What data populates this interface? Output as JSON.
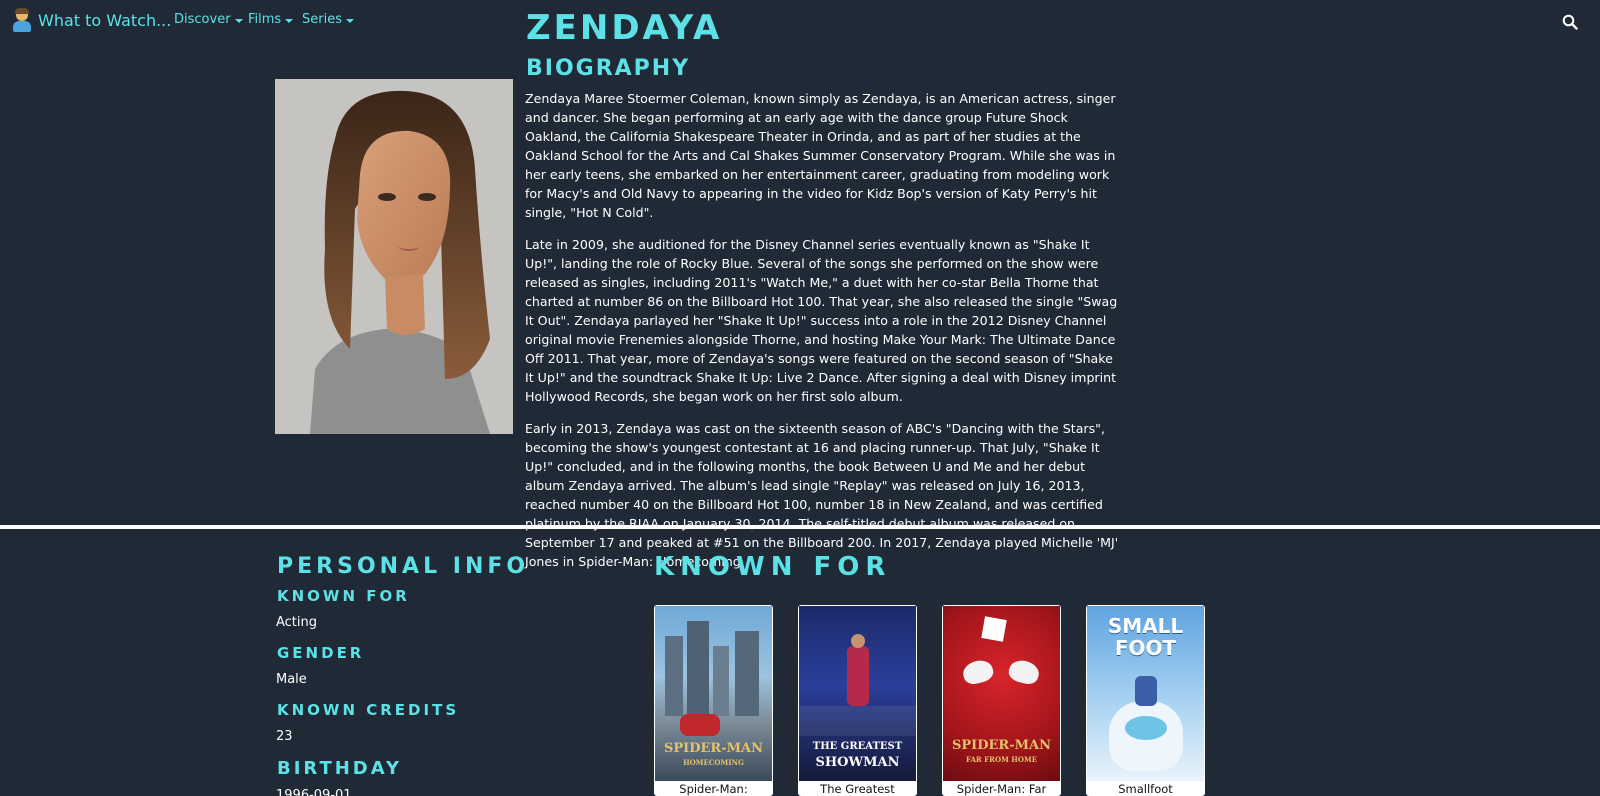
{
  "nav": {
    "brand": "What to Watch...",
    "items": [
      {
        "label": "Discover"
      },
      {
        "label": "Films"
      },
      {
        "label": "Series"
      }
    ]
  },
  "person": {
    "name": "ZENDAYA",
    "biography_heading": "BIOGRAPHY",
    "biography": [
      "Zendaya Maree Stoermer Coleman, known simply as Zendaya, is an American actress, singer and dancer. She began performing at an early age with the dance group Future Shock Oakland, the California Shakespeare Theater in Orinda, and as part of her studies at the Oakland School for the Arts and Cal Shakes Summer Conservatory Program. While she was in her early teens, she embarked on her entertainment career, graduating from modeling work for Macy's and Old Navy to appearing in the video for Kidz Bop's version of Katy Perry's hit single, \"Hot N Cold\".",
      "Late in 2009, she auditioned for the Disney Channel series eventually known as \"Shake It Up!\", landing the role of Rocky Blue. Several of the songs she performed on the show were released as singles, including 2011's \"Watch Me,\" a duet with her co-star Bella Thorne that charted at number 86 on the Billboard Hot 100. That year, she also released the single \"Swag It Out\". Zendaya parlayed her \"Shake It Up!\" success into a role in the 2012 Disney Channel original movie Frenemies alongside Thorne, and hosting Make Your Mark: The Ultimate Dance Off 2011. That year, more of Zendaya's songs were featured on the second season of \"Shake It Up!\" and the soundtrack Shake It Up: Live 2 Dance. After signing a deal with Disney imprint Hollywood Records, she began work on her first solo album.",
      "Early in 2013, Zendaya was cast on the sixteenth season of ABC's \"Dancing with the Stars\", becoming the show's youngest contestant at 16 and placing runner-up. That July, \"Shake It Up!\" concluded, and in the following months, the book Between U and Me and her debut album Zendaya arrived. The album's lead single \"Replay\" was released on July 16, 2013, reached number 40 on the Billboard Hot 100, number 18 in New Zealand, and was certified platinum by the RIAA on January 30, 2014. The self-titled debut album was released on September 17 and peaked at #51 on the Billboard 200. In 2017, Zendaya played Michelle 'MJ' Jones in Spider-Man: Homecoming."
    ]
  },
  "personal_info": {
    "title": "PERSONAL INFO",
    "fields": [
      {
        "label": "KNOWN FOR",
        "value": "Acting"
      },
      {
        "label": "GENDER",
        "value": "Male"
      },
      {
        "label": "KNOWN CREDITS",
        "value": "23"
      },
      {
        "label": "BIRTHDAY",
        "value": "1996-09-01"
      }
    ]
  },
  "known_for": {
    "title": "KNOWN FOR",
    "items": [
      {
        "title": "Spider-Man:",
        "art": "SPIDER-MAN",
        "art_sub": "HOMECOMING"
      },
      {
        "title": "The Greatest",
        "art": "THE GREATEST",
        "art_sub": "SHOWMAN"
      },
      {
        "title": "Spider-Man: Far",
        "art": "SPIDER-MAN",
        "art_sub": "FAR FROM HOME"
      },
      {
        "title": "Smallfoot",
        "art": "SMALL",
        "art_sub": "FOOT"
      }
    ]
  },
  "colors": {
    "background": "#1f2a36",
    "accent": "#5ce1e6",
    "text": "#ffffff",
    "divider": "#ffffff"
  },
  "icons": {
    "brand": "person-icon",
    "search": "search-icon",
    "dropdown": "caret-down-icon"
  }
}
